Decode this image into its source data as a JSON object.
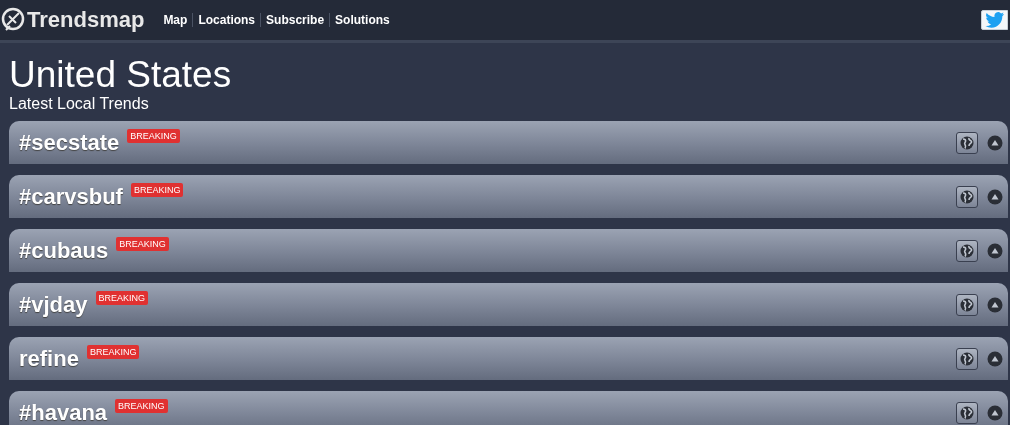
{
  "header": {
    "logo": "Trendsmap",
    "nav": [
      "Map",
      "Locations",
      "Subscribe",
      "Solutions"
    ]
  },
  "title": "United States",
  "subtitle": "Latest Local Trends",
  "trends": [
    {
      "label": "#secstate",
      "badge": "BREAKING"
    },
    {
      "label": "#carvsbuf",
      "badge": "BREAKING"
    },
    {
      "label": "#cubaus",
      "badge": "BREAKING"
    },
    {
      "label": "#vjday",
      "badge": "BREAKING"
    },
    {
      "label": "refine",
      "badge": "BREAKING"
    },
    {
      "label": "#havana",
      "badge": "BREAKING"
    }
  ]
}
